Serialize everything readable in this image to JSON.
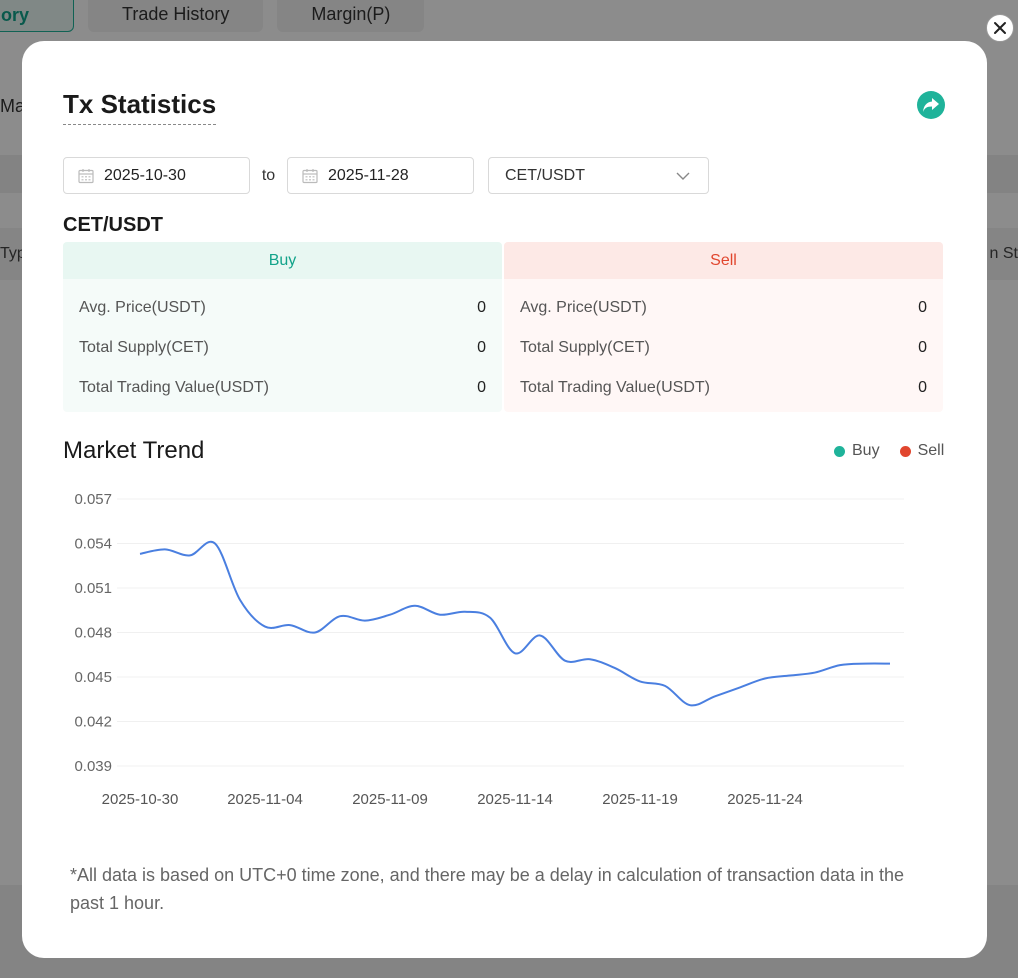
{
  "background": {
    "tabs": [
      {
        "label": "ory"
      },
      {
        "label": "Trade History"
      },
      {
        "label": "Margin(P)"
      }
    ],
    "left_fragment_1": "Ma",
    "left_fragment_2": "Typ",
    "right_fragment": "n St"
  },
  "modal": {
    "title": "Tx Statistics",
    "filters": {
      "start_date": "2025-10-30",
      "to_label": "to",
      "end_date": "2025-11-28",
      "pair_selected": "CET/USDT"
    },
    "pair_title": "CET/USDT",
    "buy": {
      "label": "Buy",
      "rows": [
        {
          "label": "Avg. Price(USDT)",
          "value": "0"
        },
        {
          "label": "Total Supply(CET)",
          "value": "0"
        },
        {
          "label": "Total Trading Value(USDT)",
          "value": "0"
        }
      ]
    },
    "sell": {
      "label": "Sell",
      "rows": [
        {
          "label": "Avg. Price(USDT)",
          "value": "0"
        },
        {
          "label": "Total Supply(CET)",
          "value": "0"
        },
        {
          "label": "Total Trading Value(USDT)",
          "value": "0"
        }
      ]
    },
    "trend_title": "Market Trend",
    "legend": [
      {
        "label": "Buy",
        "color": "#1fb39a"
      },
      {
        "label": "Sell",
        "color": "#e1462e"
      }
    ],
    "footnote": "*All data is based on UTC+0 time zone, and there may be a delay in calculation of transaction data in the past 1 hour."
  },
  "colors": {
    "accent": "#1fb39a",
    "sell": "#e1462e",
    "line": "#4a7fe0"
  },
  "chart_data": {
    "type": "line",
    "y_ticks": [
      "0.057",
      "0.054",
      "0.051",
      "0.048",
      "0.045",
      "0.042",
      "0.039"
    ],
    "ylim": [
      0.039,
      0.057
    ],
    "x_ticks": [
      "2025-10-30",
      "2025-11-04",
      "2025-11-09",
      "2025-11-14",
      "2025-11-19",
      "2025-11-24"
    ],
    "x_start": "2025-10-30",
    "x_end": "2025-11-29",
    "series": [
      {
        "color": "#4a7fe0",
        "x": [
          "2025-10-30",
          "2025-10-31",
          "2025-11-01",
          "2025-11-02",
          "2025-11-03",
          "2025-11-04",
          "2025-11-05",
          "2025-11-06",
          "2025-11-07",
          "2025-11-08",
          "2025-11-09",
          "2025-11-10",
          "2025-11-11",
          "2025-11-12",
          "2025-11-13",
          "2025-11-14",
          "2025-11-15",
          "2025-11-16",
          "2025-11-17",
          "2025-11-18",
          "2025-11-19",
          "2025-11-20",
          "2025-11-21",
          "2025-11-22",
          "2025-11-23",
          "2025-11-24",
          "2025-11-25",
          "2025-11-26",
          "2025-11-27",
          "2025-11-28",
          "2025-11-29"
        ],
        "values": [
          0.0533,
          0.0536,
          0.0532,
          0.054,
          0.0502,
          0.0484,
          0.0485,
          0.048,
          0.0491,
          0.0488,
          0.0492,
          0.0498,
          0.0492,
          0.0494,
          0.049,
          0.0466,
          0.0478,
          0.0461,
          0.0462,
          0.0456,
          0.0447,
          0.0444,
          0.0431,
          0.0437,
          0.0443,
          0.0449,
          0.0451,
          0.0453,
          0.0458,
          0.0459,
          0.0459
        ]
      }
    ],
    "grid": true
  }
}
